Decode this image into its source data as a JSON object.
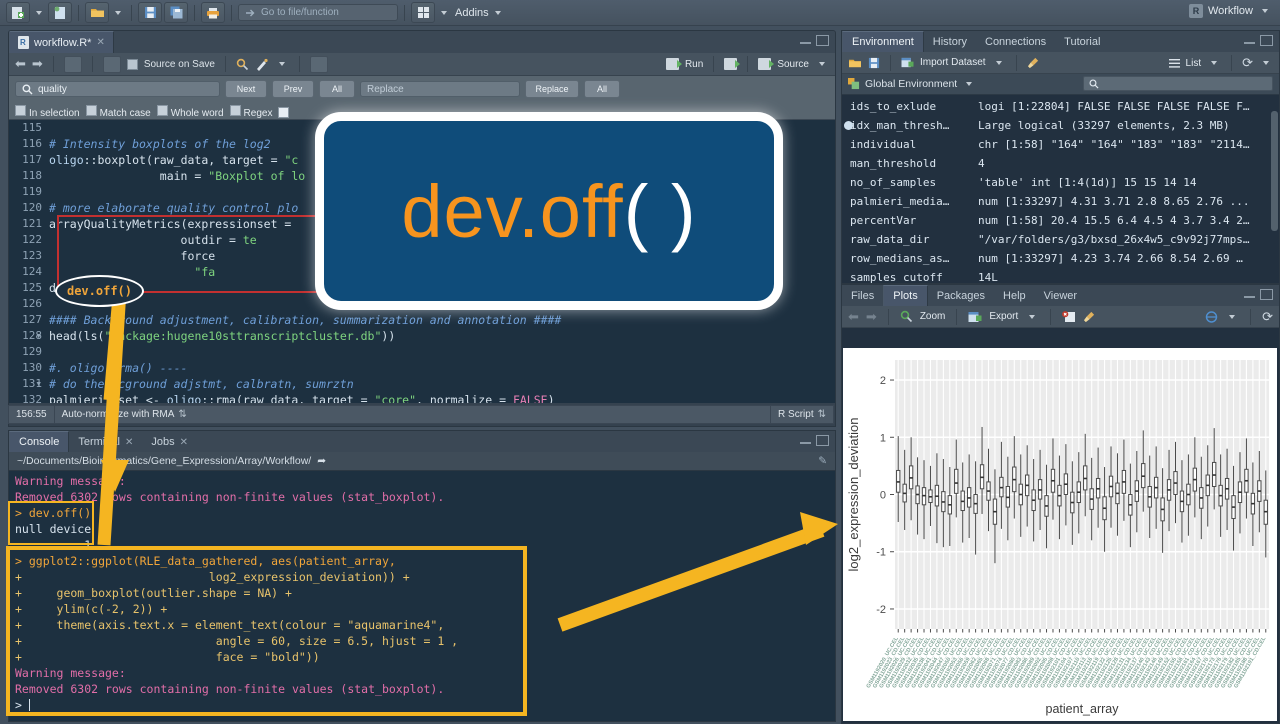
{
  "toolbar": {
    "goto_placeholder": "Go to file/function",
    "addins_label": "Addins",
    "project_label": "Workflow",
    "icons": [
      "new-file-icon",
      "new-project-icon",
      "open-folder-icon",
      "save-icon",
      "save-all-icon",
      "print-icon",
      "goto-icon",
      "grid-icon"
    ]
  },
  "source": {
    "tab_label": "workflow.R*",
    "source_on_save": "Source on Save",
    "run_label": "Run",
    "source_label": "Source",
    "find": {
      "query": "quality",
      "replace_placeholder": "Replace",
      "next_label": "Next",
      "prev_label": "Prev",
      "all_label": "All",
      "replace_label": "Replace",
      "replace_all_label": "All",
      "options": [
        "In selection",
        "Match case",
        "Whole word",
        "Regex"
      ]
    },
    "first_line_number": 115,
    "lines": [
      {
        "n": "115",
        "html": ""
      },
      {
        "n": "116",
        "html": "<span class='cmt'># Intensity boxplots of the log2</span>"
      },
      {
        "n": "117",
        "html": "<span class='ns'>oligo</span>::<span class='fn'>boxplot</span>(raw_data, target = <span class='str'>\"c</span>"
      },
      {
        "n": "118",
        "html": "                <span class='gl'>main</span> = <span class='str'>\"Boxplot of lo</span>"
      },
      {
        "n": "119",
        "html": ""
      },
      {
        "n": "120",
        "html": "<span class='cmt'># more elaborate quality control plo</span>"
      },
      {
        "n": "121",
        "html": "<span class='fn'>arrayQualityMetrics</span>(expressionset = "
      },
      {
        "n": "122",
        "html": "                   outdir = <span class='str'>te</span>"
      },
      {
        "n": "123",
        "html": "                   force"
      },
      {
        "n": "124",
        "html": "                     <span class='str'>\"fa</span>"
      },
      {
        "n": "125",
        "html": "<span class='fn'>dev.off</span>()"
      },
      {
        "n": "126",
        "html": ""
      },
      {
        "n": "127",
        "fold": true,
        "html": "<span class='cmt'>#### Background adjustment, calibration, summarization and annotation ####</span>"
      },
      {
        "n": "128",
        "html": "<span class='fn'>head</span>(<span class='fn'>ls</span>(<span class='str'>\"package:hugene10sttranscriptcluster.db\"</span>))"
      },
      {
        "n": "129",
        "html": ""
      },
      {
        "n": "130",
        "fold": true,
        "html": "<span class='cmt'>#. oligo::rma() ----</span>"
      },
      {
        "n": "131",
        "html": "<span class='cmt'># do the Bcground adjstmt, calbratn, sumrztn</span>"
      },
      {
        "n": "132",
        "html": "palmieri_eset &lt;- <span class='ns'>oligo</span>::<span class='fn'>rma</span>(raw_data, target = <span class='str'>\"core\"</span>, normalize = <span class='kw'>FALSE</span>)"
      }
    ],
    "status": {
      "cursor_position": "156:55",
      "scope": "Auto-normalize with RMA",
      "file_type": "R Script"
    }
  },
  "console": {
    "tabs": [
      "Console",
      "Terminal",
      "Jobs"
    ],
    "active_tab": "Console",
    "path": "~/Documents/Bioinformatics/Gene_Expression/Array/Workflow/",
    "lines": [
      {
        "cls": "warn",
        "text": "Warning message:"
      },
      {
        "cls": "warn",
        "text": "Removed 6302 rows containing non-finite values (stat_boxplot)."
      },
      {
        "cls": "cmd",
        "text": "> dev.off()"
      },
      {
        "cls": "cl",
        "text": "null device "
      },
      {
        "cls": "cl",
        "text": "          1 "
      },
      {
        "cls": "ggl",
        "text": "> ggplot2::ggplot(RLE_data_gathered, aes(patient_array,"
      },
      {
        "cls": "plus",
        "text": "+                           log2_expression_deviation)) +"
      },
      {
        "cls": "plus",
        "text": "+     geom_boxplot(outlier.shape = NA) +"
      },
      {
        "cls": "plus",
        "text": "+     ylim(c(-2, 2)) +"
      },
      {
        "cls": "plus",
        "text": "+     theme(axis.text.x = element_text(colour = \"aquamarine4\","
      },
      {
        "cls": "plus",
        "text": "+                            angle = 60, size = 6.5, hjust = 1 ,"
      },
      {
        "cls": "plus",
        "text": "+                            face = \"bold\"))"
      },
      {
        "cls": "warn",
        "text": "Warning message:"
      },
      {
        "cls": "warn",
        "text": "Removed 6302 rows containing non-finite values (stat_boxplot)."
      },
      {
        "cls": "prompt",
        "text": "> "
      }
    ]
  },
  "environment": {
    "tabs": [
      "Environment",
      "History",
      "Connections",
      "Tutorial"
    ],
    "active_tab": "Environment",
    "import_label": "Import Dataset",
    "view_label": "List",
    "scope_label": "Global Environment",
    "variables": [
      {
        "name": "ids_to_exlude",
        "value": "logi [1:22804] FALSE FALSE FALSE FALSE F…",
        "expandable": false
      },
      {
        "name": "idx_man_thresh…",
        "value": "Large logical (33297 elements, 2.3 MB)",
        "expandable": true
      },
      {
        "name": "individual",
        "value": "chr [1:58] \"164\" \"164\" \"183\" \"183\" \"2114…",
        "expandable": false
      },
      {
        "name": "man_threshold",
        "value": "4",
        "expandable": false
      },
      {
        "name": "no_of_samples",
        "value": "'table' int [1:4(1d)] 15 15 14 14",
        "expandable": false
      },
      {
        "name": "palmieri_media…",
        "value": "num [1:33297] 4.31 3.71 2.8 8.65 2.76 ...",
        "expandable": false
      },
      {
        "name": "percentVar",
        "value": "num [1:58] 20.4 15.5 6.4 4.5 4 3.7 3.4 2…",
        "expandable": false
      },
      {
        "name": "raw_data_dir",
        "value": "\"/var/folders/g3/bxsd_26x4w5_c9v92j77mps…",
        "expandable": false
      },
      {
        "name": "row_medians_as…",
        "value": "num [1:33297] 4.23 3.74 2.66 8.54 2.69  …",
        "expandable": false
      },
      {
        "name": "samples_cutoff",
        "value": "14L",
        "expandable": false
      }
    ]
  },
  "plots": {
    "tabs": [
      "Files",
      "Plots",
      "Packages",
      "Help",
      "Viewer"
    ],
    "active_tab": "Plots",
    "zoom_label": "Zoom",
    "export_label": "Export"
  },
  "annotations": {
    "callout_text_main": "dev.off",
    "callout_text_paren": "( )",
    "ellipse_label": "dev.off()",
    "highlight_color": "#f5b521",
    "redbox_color": "#c33030",
    "callout_bg": "#0f4c7a",
    "callout_fg": "#f7941e"
  },
  "chart_data": {
    "type": "box",
    "title": "",
    "xlabel": "patient_array",
    "ylabel": "log2_expression_deviation",
    "ylim": [
      -2.35,
      2.35
    ],
    "yticks": [
      -2,
      -1,
      0,
      1,
      2
    ],
    "grid": true,
    "panel_bg": "#ebebeb",
    "n_boxes": 58,
    "tick_label_color": "#84a79a",
    "tick_label_angle": 60,
    "boxes": [
      {
        "median": 0.22,
        "q1": 0.04,
        "q3": 0.42,
        "lo": -0.48,
        "hi": 1.02
      },
      {
        "median": 0.02,
        "q1": -0.13,
        "q3": 0.18,
        "lo": -0.62,
        "hi": 0.78
      },
      {
        "median": 0.29,
        "q1": 0.1,
        "q3": 0.5,
        "lo": -0.45,
        "hi": 1.0
      },
      {
        "median": 0.0,
        "q1": -0.16,
        "q3": 0.15,
        "lo": -0.7,
        "hi": 0.65
      },
      {
        "median": -0.02,
        "q1": -0.18,
        "q3": 0.12,
        "lo": -0.78,
        "hi": 0.6
      },
      {
        "median": -0.04,
        "q1": -0.14,
        "q3": 0.08,
        "lo": -0.55,
        "hi": 0.5
      },
      {
        "median": -0.03,
        "q1": -0.2,
        "q3": 0.16,
        "lo": -0.85,
        "hi": 0.72
      },
      {
        "median": -0.13,
        "q1": -0.3,
        "q3": 0.05,
        "lo": -0.92,
        "hi": 0.62
      },
      {
        "median": -0.18,
        "q1": -0.34,
        "q3": -0.02,
        "lo": -0.9,
        "hi": 0.48
      },
      {
        "median": 0.2,
        "q1": 0.02,
        "q3": 0.44,
        "lo": -0.4,
        "hi": 0.96
      },
      {
        "median": -0.12,
        "q1": -0.28,
        "q3": 0.06,
        "lo": -0.84,
        "hi": 0.56
      },
      {
        "median": -0.06,
        "q1": -0.22,
        "q3": 0.12,
        "lo": -0.76,
        "hi": 0.7
      },
      {
        "median": -0.16,
        "q1": -0.33,
        "q3": 0.0,
        "lo": -1.05,
        "hi": 0.58
      },
      {
        "median": 0.3,
        "q1": 0.1,
        "q3": 0.52,
        "lo": -0.34,
        "hi": 1.18
      },
      {
        "median": 0.06,
        "q1": -0.1,
        "q3": 0.22,
        "lo": -0.64,
        "hi": 0.8
      },
      {
        "median": -0.3,
        "q1": -0.52,
        "q3": -0.08,
        "lo": -1.2,
        "hi": 0.44
      },
      {
        "median": 0.12,
        "q1": -0.04,
        "q3": 0.3,
        "lo": -0.6,
        "hi": 0.92
      },
      {
        "median": -0.05,
        "q1": -0.22,
        "q3": 0.14,
        "lo": -0.8,
        "hi": 0.66
      },
      {
        "median": 0.26,
        "q1": 0.05,
        "q3": 0.48,
        "lo": -0.42,
        "hi": 1.02
      },
      {
        "median": 0.0,
        "q1": -0.18,
        "q3": 0.18,
        "lo": -0.74,
        "hi": 0.7
      },
      {
        "median": 0.16,
        "q1": -0.02,
        "q3": 0.34,
        "lo": -0.56,
        "hi": 0.86
      },
      {
        "median": -0.1,
        "q1": -0.28,
        "q3": 0.08,
        "lo": -0.82,
        "hi": 0.62
      },
      {
        "median": 0.08,
        "q1": -0.08,
        "q3": 0.26,
        "lo": -0.62,
        "hi": 0.78
      },
      {
        "median": -0.2,
        "q1": -0.38,
        "q3": -0.02,
        "lo": -0.94,
        "hi": 0.52
      },
      {
        "median": 0.24,
        "q1": 0.04,
        "q3": 0.44,
        "lo": -0.44,
        "hi": 0.98
      },
      {
        "median": -0.02,
        "q1": -0.2,
        "q3": 0.16,
        "lo": -0.78,
        "hi": 0.68
      },
      {
        "median": 0.18,
        "q1": 0.0,
        "q3": 0.36,
        "lo": -0.54,
        "hi": 0.88
      },
      {
        "median": -0.14,
        "q1": -0.32,
        "q3": 0.04,
        "lo": -0.88,
        "hi": 0.58
      },
      {
        "median": 0.04,
        "q1": -0.14,
        "q3": 0.22,
        "lo": -0.68,
        "hi": 0.74
      },
      {
        "median": 0.28,
        "q1": 0.08,
        "q3": 0.5,
        "lo": -0.38,
        "hi": 1.06
      },
      {
        "median": -0.08,
        "q1": -0.26,
        "q3": 0.1,
        "lo": -0.8,
        "hi": 0.64
      },
      {
        "median": 0.1,
        "q1": -0.06,
        "q3": 0.28,
        "lo": -0.58,
        "hi": 0.82
      },
      {
        "median": -0.24,
        "q1": -0.44,
        "q3": -0.04,
        "lo": -1.0,
        "hi": 0.48
      },
      {
        "median": 0.14,
        "q1": -0.04,
        "q3": 0.32,
        "lo": -0.58,
        "hi": 0.84
      },
      {
        "median": 0.02,
        "q1": -0.16,
        "q3": 0.2,
        "lo": -0.72,
        "hi": 0.72
      },
      {
        "median": 0.22,
        "q1": 0.02,
        "q3": 0.42,
        "lo": -0.46,
        "hi": 0.96
      },
      {
        "median": -0.18,
        "q1": -0.36,
        "q3": 0.0,
        "lo": -0.92,
        "hi": 0.54
      },
      {
        "median": 0.06,
        "q1": -0.12,
        "q3": 0.24,
        "lo": -0.66,
        "hi": 0.76
      },
      {
        "median": 0.32,
        "q1": 0.12,
        "q3": 0.54,
        "lo": -0.3,
        "hi": 1.12
      },
      {
        "median": -0.04,
        "q1": -0.22,
        "q3": 0.14,
        "lo": -0.76,
        "hi": 0.68
      },
      {
        "median": 0.12,
        "q1": -0.06,
        "q3": 0.3,
        "lo": -0.6,
        "hi": 0.84
      },
      {
        "median": -0.26,
        "q1": -0.46,
        "q3": -0.06,
        "lo": -1.02,
        "hi": 0.46
      },
      {
        "median": 0.08,
        "q1": -0.1,
        "q3": 0.26,
        "lo": -0.64,
        "hi": 0.78
      },
      {
        "median": 0.2,
        "q1": 0.0,
        "q3": 0.4,
        "lo": -0.5,
        "hi": 0.92
      },
      {
        "median": -0.12,
        "q1": -0.3,
        "q3": 0.06,
        "lo": -0.84,
        "hi": 0.6
      },
      {
        "median": 0.0,
        "q1": -0.18,
        "q3": 0.18,
        "lo": -0.72,
        "hi": 0.7
      },
      {
        "median": 0.26,
        "q1": 0.06,
        "q3": 0.46,
        "lo": -0.4,
        "hi": 1.0
      },
      {
        "median": -0.06,
        "q1": -0.24,
        "q3": 0.12,
        "lo": -0.78,
        "hi": 0.66
      },
      {
        "median": 0.16,
        "q1": -0.02,
        "q3": 0.34,
        "lo": -0.56,
        "hi": 0.86
      },
      {
        "median": 0.34,
        "q1": 0.14,
        "q3": 0.56,
        "lo": -0.26,
        "hi": 1.16
      },
      {
        "median": -0.02,
        "q1": -0.2,
        "q3": 0.16,
        "lo": -0.74,
        "hi": 0.7
      },
      {
        "median": 0.1,
        "q1": -0.08,
        "q3": 0.28,
        "lo": -0.62,
        "hi": 0.8
      },
      {
        "median": -0.22,
        "q1": -0.42,
        "q3": -0.02,
        "lo": -0.98,
        "hi": 0.5
      },
      {
        "median": 0.04,
        "q1": -0.14,
        "q3": 0.22,
        "lo": -0.68,
        "hi": 0.74
      },
      {
        "median": 0.24,
        "q1": 0.04,
        "q3": 0.44,
        "lo": -0.42,
        "hi": 0.98
      },
      {
        "median": -0.16,
        "q1": -0.34,
        "q3": 0.02,
        "lo": -0.9,
        "hi": 0.56
      },
      {
        "median": 0.06,
        "q1": -0.12,
        "q3": 0.24,
        "lo": -0.66,
        "hi": 0.76
      },
      {
        "median": -0.3,
        "q1": -0.52,
        "q3": -0.1,
        "lo": -1.1,
        "hi": 0.42
      }
    ]
  }
}
